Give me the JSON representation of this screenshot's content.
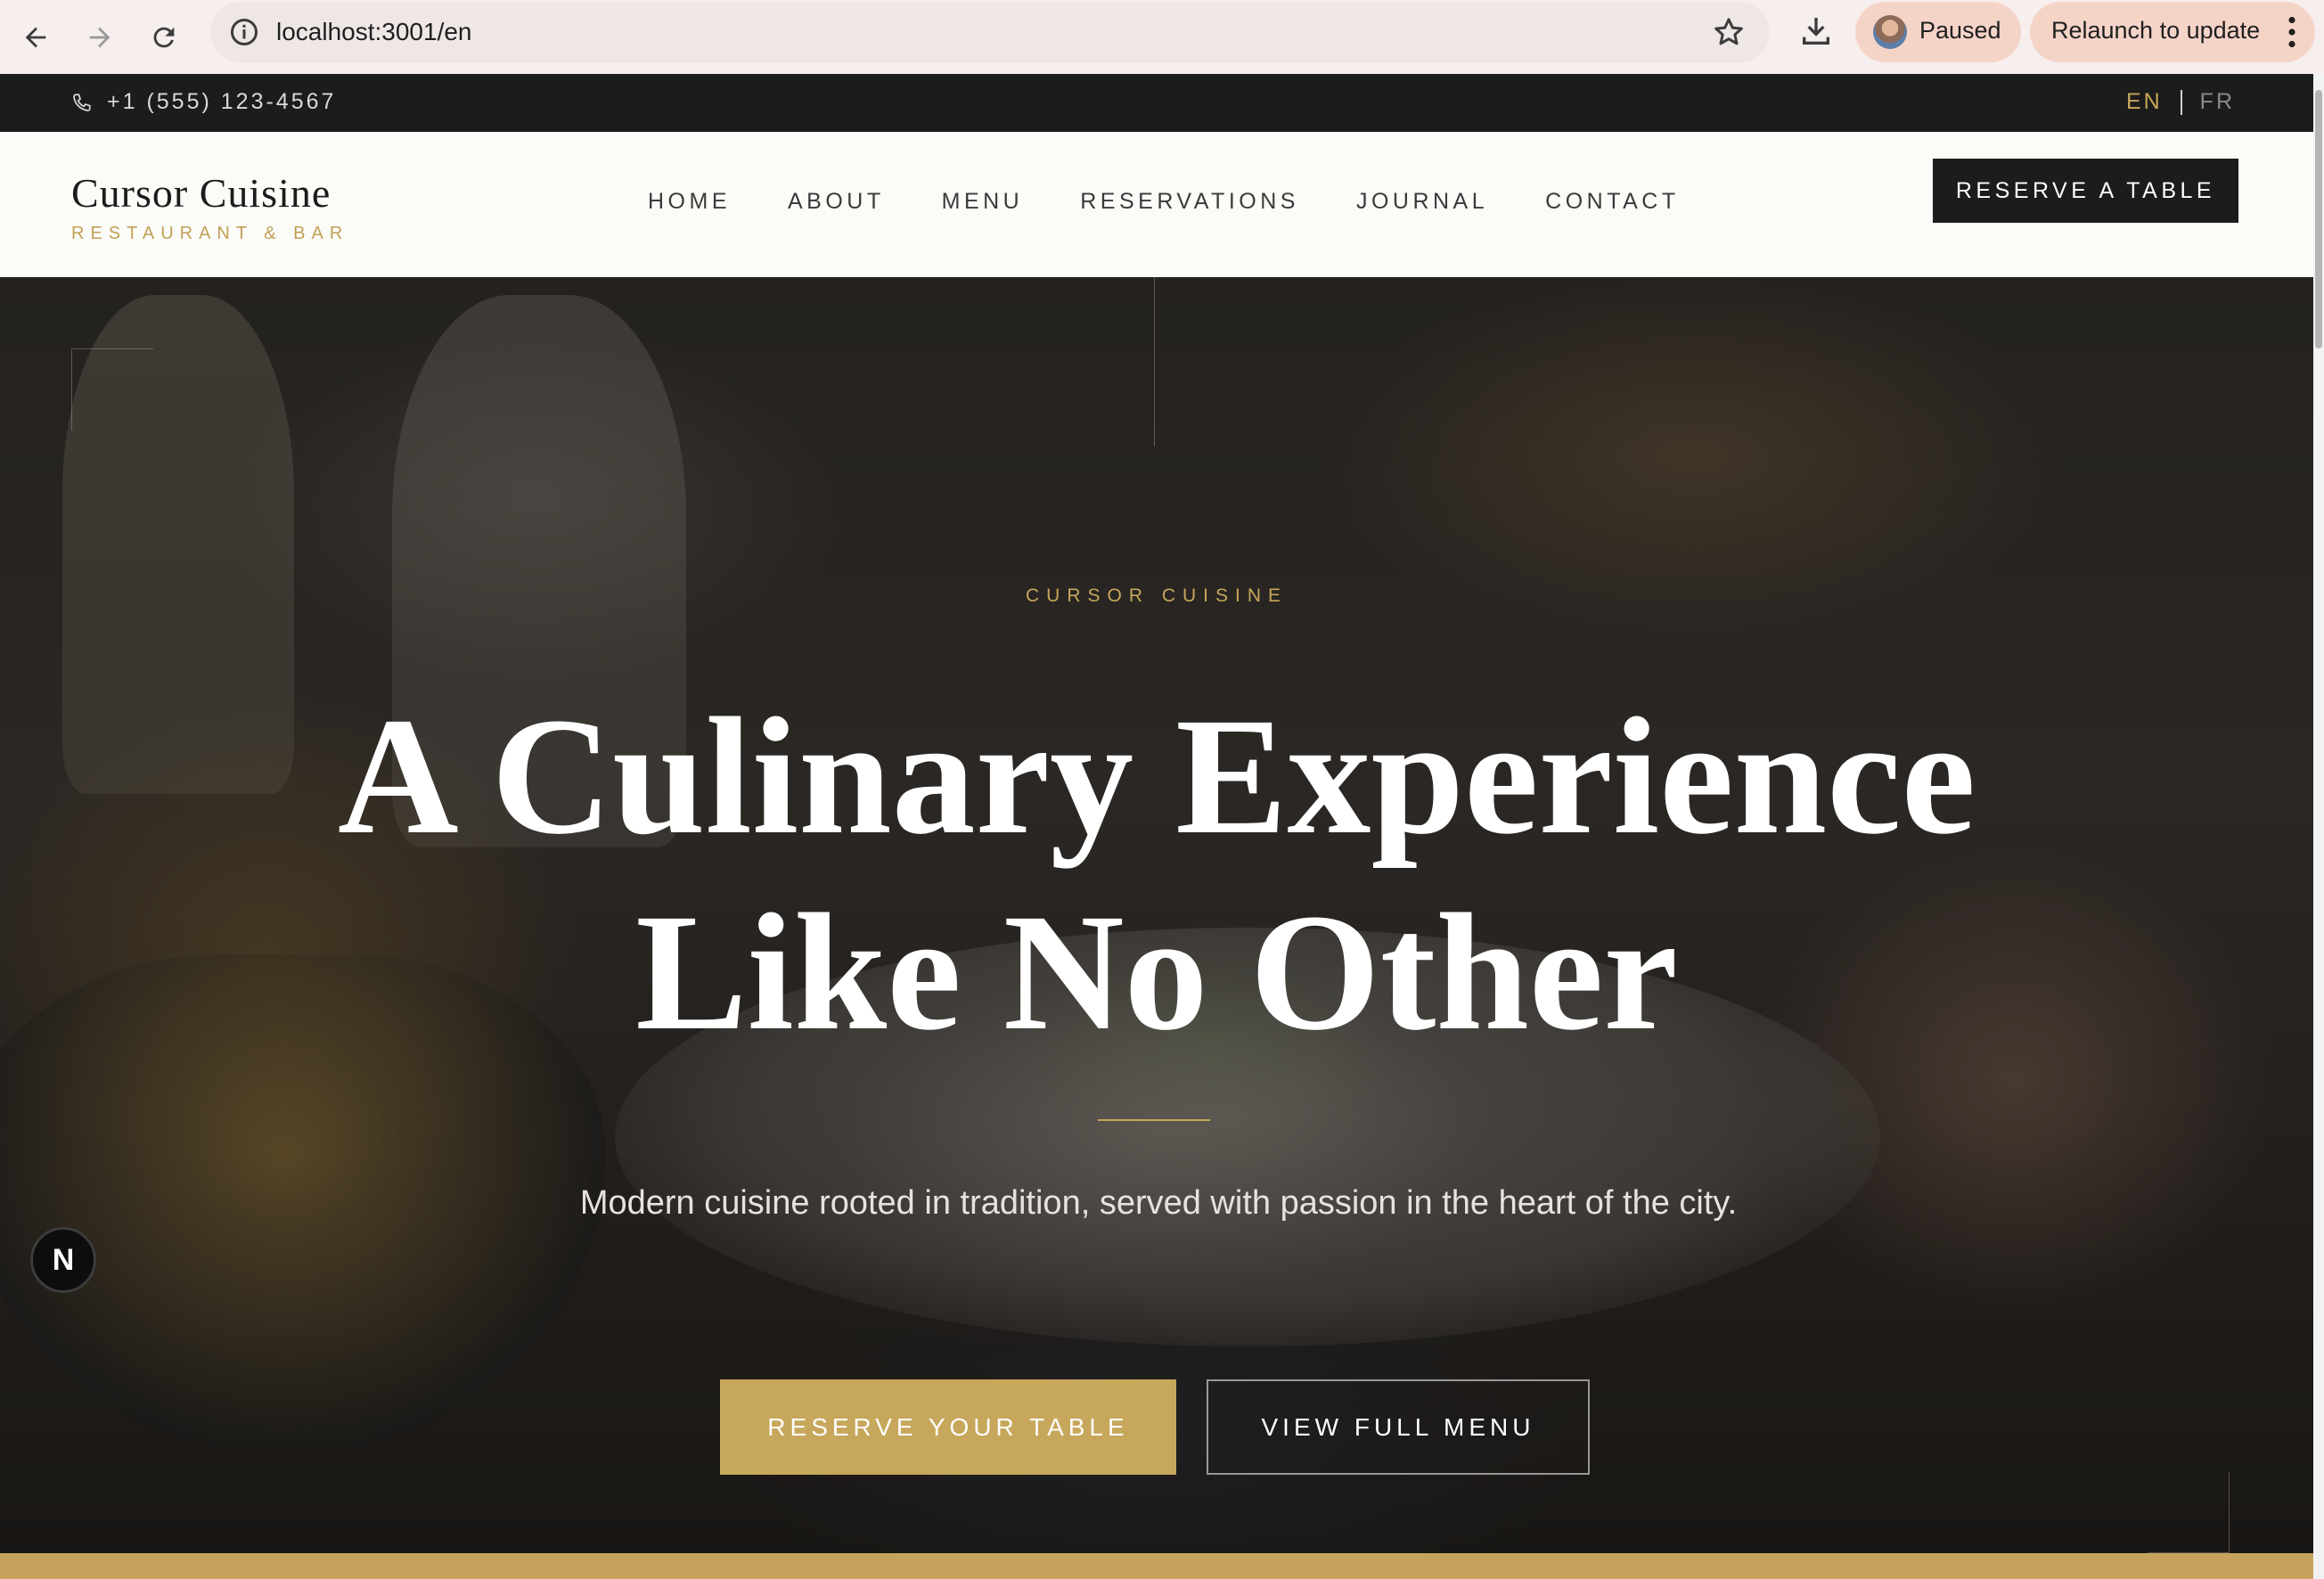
{
  "browser": {
    "url": "localhost:3001/en",
    "profile_status": "Paused",
    "relaunch_label": "Relaunch to update"
  },
  "topbar": {
    "phone": "+1 (555) 123-4567",
    "lang_en": "EN",
    "lang_fr": "FR"
  },
  "header": {
    "logo_title": "Cursor Cuisine",
    "logo_subtitle": "RESTAURANT & BAR",
    "nav": [
      "HOME",
      "ABOUT",
      "MENU",
      "RESERVATIONS",
      "JOURNAL",
      "CONTACT"
    ],
    "reserve_label": "RESERVE A TABLE"
  },
  "hero": {
    "eyebrow": "CURSOR CUISINE",
    "headline_line1": "A Culinary Experience",
    "headline_line2": "Like No Other",
    "subtext": "Modern cuisine rooted in tradition, served with passion in the heart of the city.",
    "cta_primary": "RESERVE YOUR TABLE",
    "cta_secondary": "VIEW FULL MENU"
  },
  "dev_badge": "N",
  "colors": {
    "accent_gold": "#c7a75b",
    "dark": "#1c1c1c",
    "header_bg": "#fbfbf8",
    "chrome_bg": "#f7eeee",
    "pill_bg": "#f5d4c8"
  }
}
